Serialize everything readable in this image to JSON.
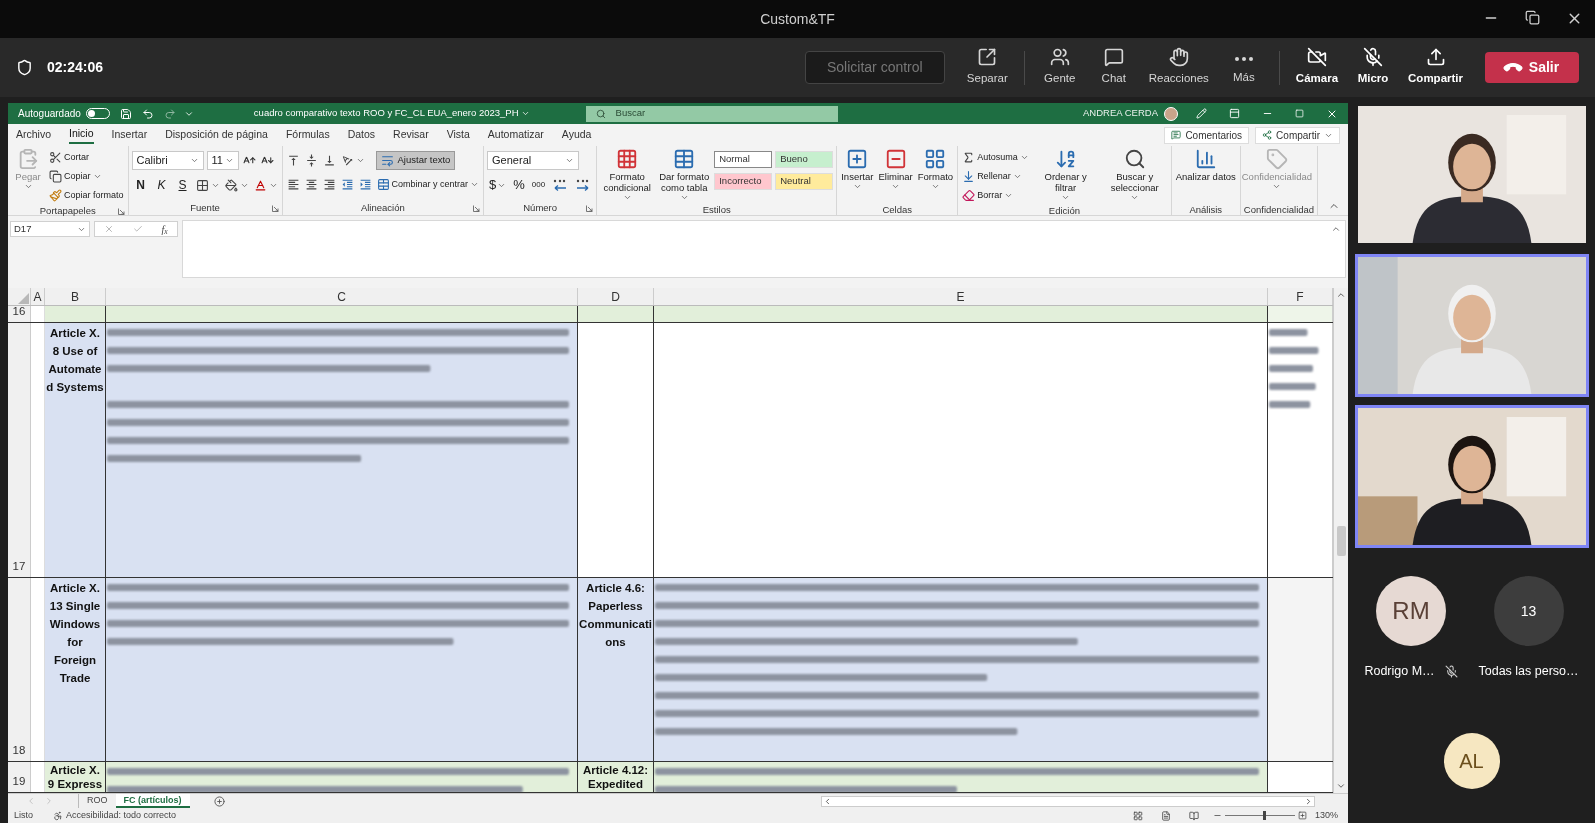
{
  "window": {
    "title": "Custom&TF"
  },
  "meeting_bar": {
    "timer": "02:24:06",
    "request_control": "Solicitar control",
    "action_groups": [
      [
        {
          "kind": "popout",
          "label": "Separar"
        }
      ],
      [
        {
          "kind": "people",
          "label": "Gente"
        },
        {
          "kind": "chat",
          "label": "Chat"
        },
        {
          "kind": "reactions",
          "label": "Reacciones"
        },
        {
          "kind": "more",
          "label": "Más"
        }
      ],
      [
        {
          "kind": "camera-off",
          "label": "Cámara"
        },
        {
          "kind": "mic-off",
          "label": "Micro"
        },
        {
          "kind": "share",
          "label": "Compartir"
        }
      ]
    ],
    "leave": "Salir"
  },
  "excel": {
    "title_bar": {
      "autosave": "Autoguardado",
      "autosave_on": false,
      "file_name": "cuadro comparativo texto ROO y FC_CL EUA_enero 2023_PH",
      "search_placeholder": "Buscar",
      "user": "ANDREA CERDA"
    },
    "ribbon_tabs": [
      {
        "label": "Archivo",
        "selected": false
      },
      {
        "label": "Inicio",
        "selected": true
      },
      {
        "label": "Insertar",
        "selected": false
      },
      {
        "label": "Disposición de página",
        "selected": false
      },
      {
        "label": "Fórmulas",
        "selected": false
      },
      {
        "label": "Datos",
        "selected": false
      },
      {
        "label": "Revisar",
        "selected": false
      },
      {
        "label": "Vista",
        "selected": false
      },
      {
        "label": "Automatizar",
        "selected": false
      },
      {
        "label": "Ayuda",
        "selected": false
      }
    ],
    "comments": "Comentarios",
    "share": "Compartir",
    "ribbon_groups": [
      {
        "label": "Portapapeles",
        "launcher": true,
        "columns": [
          {
            "kind": "large",
            "lines": [
              [
                {
                  "kind": "paste",
                  "label": "Pegar",
                  "disabled": true
                }
              ]
            ]
          },
          {
            "kind": "stack",
            "lines": [
              [
                {
                  "kind": "cut",
                  "label": "Cortar"
                }
              ],
              [
                {
                  "kind": "copy",
                  "label": "Copiar"
                }
              ],
              [
                {
                  "kind": "painter",
                  "label": "Copiar formato"
                }
              ]
            ]
          }
        ]
      },
      {
        "label": "Fuente",
        "launcher": true,
        "columns": [
          {
            "kind": "stack",
            "lines": [
              [
                {
                  "kind": "font-select",
                  "label": "Calibri"
                },
                {
                  "kind": "size-select",
                  "label": "11"
                },
                {
                  "kind": "grow"
                },
                {
                  "kind": "shrink"
                }
              ],
              [
                {
                  "kind": "bold",
                  "label": "N"
                },
                {
                  "kind": "italic",
                  "label": "K"
                },
                {
                  "kind": "underline",
                  "label": "S"
                },
                {
                  "kind": "borders"
                },
                {
                  "kind": "fill"
                },
                {
                  "kind": "font-color"
                }
              ]
            ]
          }
        ]
      },
      {
        "label": "Alineación",
        "launcher": true,
        "columns": [
          {
            "kind": "stack",
            "lines": [
              [
                {
                  "kind": "align-top"
                },
                {
                  "kind": "align-middle"
                },
                {
                  "kind": "align-bottom"
                },
                {
                  "kind": "orientation"
                }
              ],
              [
                {
                  "kind": "align-left"
                },
                {
                  "kind": "align-center"
                },
                {
                  "kind": "align-right"
                },
                {
                  "kind": "indent-less"
                },
                {
                  "kind": "indent-more"
                }
              ]
            ]
          },
          {
            "kind": "stack",
            "lines": [
              [
                {
                  "kind": "toggle",
                  "label": "Ajustar texto",
                  "selected": true
                }
              ],
              [
                {
                  "kind": "merge",
                  "label": "Combinar y centrar"
                }
              ]
            ]
          }
        ]
      },
      {
        "label": "Número",
        "launcher": true,
        "columns": [
          {
            "kind": "stack",
            "lines": [
              [
                {
                  "kind": "format-select",
                  "label": "General"
                }
              ],
              [
                {
                  "kind": "currency",
                  "label": "$"
                },
                {
                  "kind": "percent",
                  "label": "%"
                },
                {
                  "kind": "thousands",
                  "label": "000"
                },
                {
                  "kind": "decimal-more"
                },
                {
                  "kind": "decimal-less"
                }
              ]
            ]
          }
        ]
      },
      {
        "label": "Estilos",
        "launcher": false,
        "columns": [
          {
            "kind": "large",
            "lines": [
              [
                {
                  "kind": "conditional",
                  "label": "Formato condicional",
                  "disabled": false
                }
              ]
            ]
          },
          {
            "kind": "large",
            "lines": [
              [
                {
                  "kind": "table-format",
                  "label": "Dar formato como tabla",
                  "disabled": false
                }
              ]
            ]
          },
          {
            "kind": "stack",
            "lines": [
              [
                {
                  "kind": "style",
                  "label": "Normal",
                  "color": "#ffffff"
                },
                {
                  "kind": "style",
                  "label": "Bueno",
                  "color": "#c6efce"
                }
              ],
              [
                {
                  "kind": "style",
                  "label": "Incorrecto",
                  "color": "#ffc7ce"
                },
                {
                  "kind": "style",
                  "label": "Neutral",
                  "color": "#ffeb9c"
                }
              ]
            ]
          }
        ]
      },
      {
        "label": "Celdas",
        "launcher": false,
        "columns": [
          {
            "kind": "large",
            "lines": [
              [
                {
                  "kind": "insert",
                  "label": "Insertar",
                  "disabled": false
                }
              ]
            ]
          },
          {
            "kind": "large",
            "lines": [
              [
                {
                  "kind": "delete",
                  "label": "Eliminar",
                  "disabled": false
                }
              ]
            ]
          },
          {
            "kind": "large",
            "lines": [
              [
                {
                  "kind": "format",
                  "label": "Formato",
                  "disabled": false
                }
              ]
            ]
          }
        ]
      },
      {
        "label": "Edición",
        "launcher": false,
        "columns": [
          {
            "kind": "stack",
            "lines": [
              [
                {
                  "kind": "autosum",
                  "label": "Autosuma"
                }
              ],
              [
                {
                  "kind": "fill-down",
                  "label": "Rellenar"
                }
              ],
              [
                {
                  "kind": "clear",
                  "label": "Borrar"
                }
              ]
            ]
          },
          {
            "kind": "large",
            "lines": [
              [
                {
                  "kind": "sort",
                  "label": "Ordenar y filtrar",
                  "disabled": false
                }
              ]
            ]
          },
          {
            "kind": "large",
            "lines": [
              [
                {
                  "kind": "find",
                  "label": "Buscar y seleccionar",
                  "disabled": false
                }
              ]
            ]
          }
        ]
      },
      {
        "label": "Análisis",
        "launcher": false,
        "columns": [
          {
            "kind": "large",
            "lines": [
              [
                {
                  "kind": "analyze",
                  "label": "Analizar datos",
                  "disabled": false
                }
              ]
            ]
          }
        ]
      },
      {
        "label": "Confidencialidad",
        "launcher": false,
        "columns": [
          {
            "kind": "large",
            "lines": [
              [
                {
                  "kind": "sensitivity",
                  "label": "Confidencialidad",
                  "disabled": true
                }
              ]
            ]
          }
        ]
      }
    ],
    "formula_bar": {
      "name_box": "D17",
      "function_label": "f$_{x}$"
    },
    "sheet": {
      "columns": [
        {
          "label": "A"
        },
        {
          "label": "B"
        },
        {
          "label": "C"
        },
        {
          "label": "D"
        },
        {
          "label": "E"
        },
        {
          "label": "F"
        }
      ],
      "rows": [
        {
          "number": "16",
          "cells": [
            {
              "color": "#e2efda"
            },
            {
              "color": "#e2efda"
            },
            {
              "color": "#e2efda"
            },
            {
              "color": "#e2efda"
            },
            {
              "color": "#eef5e9"
            }
          ]
        },
        {
          "number": "17",
          "cells": [
            {
              "color": "#d9e1f2",
              "text": "Article X. 8 Use of Automated Systems"
            },
            {
              "color": "#d9e1f2",
              "kind": "blurred"
            },
            {
              "color": "#ffffff"
            },
            {
              "color": "#ffffff"
            },
            {
              "color": "#ffffff",
              "kind": "blurred"
            }
          ]
        },
        {
          "number": "18",
          "cells": [
            {
              "color": "#d9e1f2",
              "text": "Article X. 13 Single Windows for Foreign Trade"
            },
            {
              "color": "#d9e1f2",
              "kind": "blurred"
            },
            {
              "color": "#d9e1f2",
              "text": "Article 4.6: Paperless Communications"
            },
            {
              "color": "#d9e1f2",
              "kind": "blurred"
            },
            {
              "color": "#f4f4f4"
            }
          ]
        },
        {
          "number": "19",
          "cells": [
            {
              "color": "#e2efda",
              "text": "Article X. 9 Express"
            },
            {
              "color": "#e2efda",
              "kind": "blurred"
            },
            {
              "color": "#e2efda",
              "text": "Article 4.12: Expedited"
            },
            {
              "color": "#e2efda",
              "kind": "blurred"
            },
            {
              "color": "#ffffff"
            }
          ]
        }
      ]
    },
    "sheet_tabs": [
      {
        "label": "ROO",
        "selected": false
      },
      {
        "label": "FC (artículos)",
        "selected": true
      }
    ],
    "status_bar": {
      "ready": "Listo",
      "accessibility": "Accesibilidad: todo correcto",
      "zoom_slider": {
        "level": 0.56
      },
      "zoom": "130%"
    }
  },
  "video_tiles": [
    {
      "kind": "picture",
      "highlighted": false
    },
    {
      "kind": "picture",
      "highlighted": true
    },
    {
      "kind": "picture",
      "highlighted": true
    }
  ],
  "participants": [
    {
      "initials": "RM",
      "name": "Rodrigo M…",
      "muted": true,
      "color": "#e6d9d3"
    },
    {
      "initials": "13",
      "name": "Todas las perso…",
      "muted": false,
      "color": "#3d3d3d"
    }
  ],
  "bottom_avatar": {
    "initials": "AL",
    "color": "#f6e7c1"
  }
}
